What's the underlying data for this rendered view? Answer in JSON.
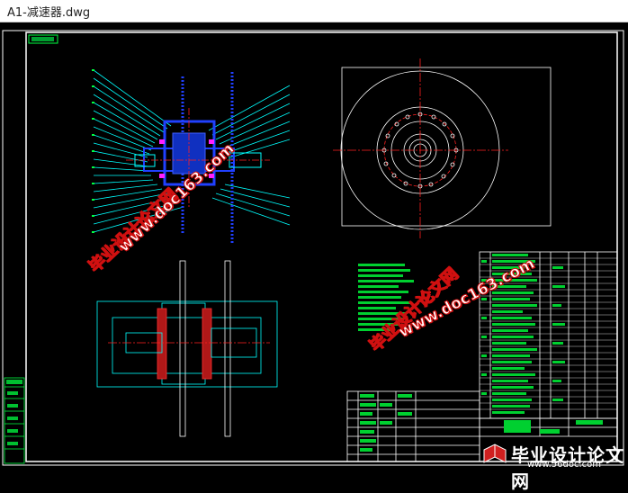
{
  "window": {
    "title": "A1-减速器.dwg"
  },
  "drawing": {
    "frame_color": "#ffffff",
    "line_color": "#00ffff",
    "part_color": "#2040ff",
    "center_color": "#ff2020",
    "text_color": "#00ff40"
  },
  "watermark": {
    "cn": "毕业设计论文网",
    "url": "www.doc163.com"
  },
  "brand": {
    "cn": "毕业设计论文网",
    "url": "www.56doc.com"
  }
}
